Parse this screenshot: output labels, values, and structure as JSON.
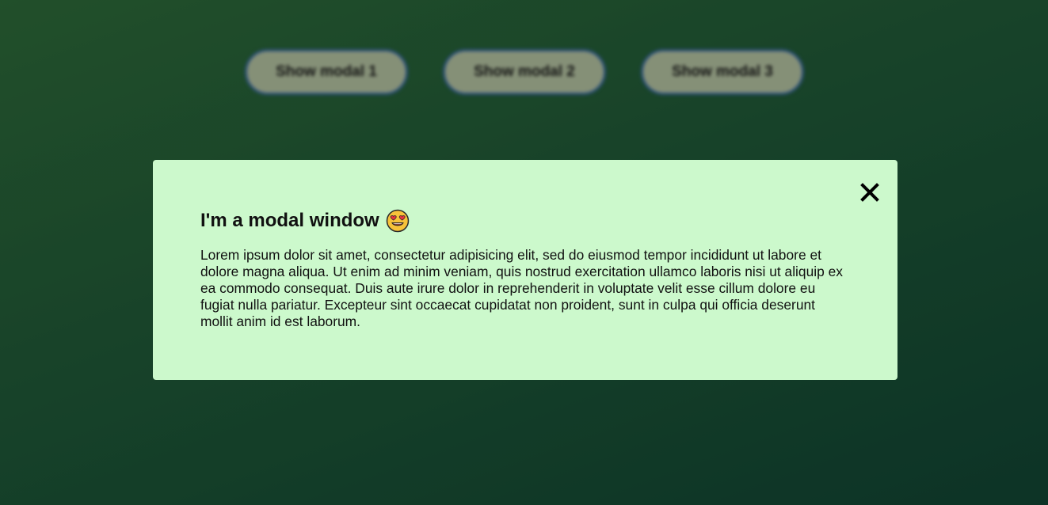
{
  "buttons": [
    {
      "label": "Show modal 1"
    },
    {
      "label": "Show modal 2"
    },
    {
      "label": "Show modal 3"
    }
  ],
  "modal": {
    "title": "I'm a modal window",
    "title_emoji": "smiling-face-with-heart-eyes-icon",
    "close_icon": "close-icon",
    "body": "Lorem ipsum dolor sit amet, consectetur adipisicing elit, sed do eiusmod tempor incididunt ut labore et dolore magna aliqua. Ut enim ad minim veniam, quis nostrud exercitation ullamco laboris nisi ut aliquip ex ea commodo consequat. Duis aute irure dolor in reprehenderit in voluptate velit esse cillum dolore eu fugiat nulla pariatur. Excepteur sint occaecat cupidatat non proident, sunt in culpa qui officia deserunt mollit anim id est laborum."
  },
  "colors": {
    "background_start": "#2f6e3b",
    "background_end": "#124735",
    "modal_background": "#ccf9cc",
    "button_border": "#3f6fa4"
  }
}
